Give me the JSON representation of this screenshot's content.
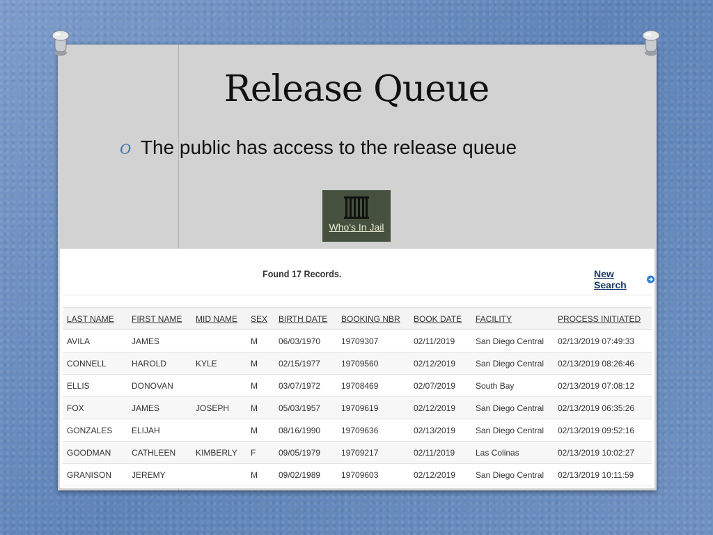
{
  "slide": {
    "title": "Release Queue",
    "bullet_mark": "O",
    "bullet_text": "The public has access to the release queue"
  },
  "jail_button": {
    "label": "Who's In Jail"
  },
  "results": {
    "found_text": "Found 17 Records.",
    "new_search_label": "New Search",
    "columns": [
      "LAST NAME",
      "FIRST NAME",
      "MID NAME",
      "SEX",
      "BIRTH DATE",
      "BOOKING NBR",
      "BOOK DATE",
      "FACILITY",
      "PROCESS INITIATED"
    ],
    "rows": [
      [
        "AVILA",
        "JAMES",
        "",
        "M",
        "06/03/1970",
        "19709307",
        "02/11/2019",
        "San Diego Central",
        "02/13/2019 07:49:33"
      ],
      [
        "CONNELL",
        "HAROLD",
        "KYLE",
        "M",
        "02/15/1977",
        "19709560",
        "02/12/2019",
        "San Diego Central",
        "02/13/2019 08:26:46"
      ],
      [
        "ELLIS",
        "DONOVAN",
        "",
        "M",
        "03/07/1972",
        "19708469",
        "02/07/2019",
        "South Bay",
        "02/13/2019 07:08:12"
      ],
      [
        "FOX",
        "JAMES",
        "JOSEPH",
        "M",
        "05/03/1957",
        "19709619",
        "02/12/2019",
        "San Diego Central",
        "02/13/2019 06:35:26"
      ],
      [
        "GONZALES",
        "ELIJAH",
        "",
        "M",
        "08/16/1990",
        "19709636",
        "02/13/2019",
        "San Diego Central",
        "02/13/2019 09:52:16"
      ],
      [
        "GOODMAN",
        "CATHLEEN",
        "KIMBERLY",
        "F",
        "09/05/1979",
        "19709217",
        "02/11/2019",
        "Las Colinas",
        "02/13/2019 10:02:27"
      ],
      [
        "GRANISON",
        "JEREMY",
        "",
        "M",
        "09/02/1989",
        "19709603",
        "02/12/2019",
        "San Diego Central",
        "02/13/2019 10:11:59"
      ]
    ]
  },
  "colors": {
    "background": "#6d8fbf",
    "slide": "#d2d2d2",
    "accent": "#3e6fb0",
    "jail_button": "#46503f",
    "link": "#1a3a6a"
  },
  "icons": {
    "pin": "push-pin-icon",
    "bars": "jail-bars-icon",
    "arrow": "arrow-circle-right-icon"
  }
}
